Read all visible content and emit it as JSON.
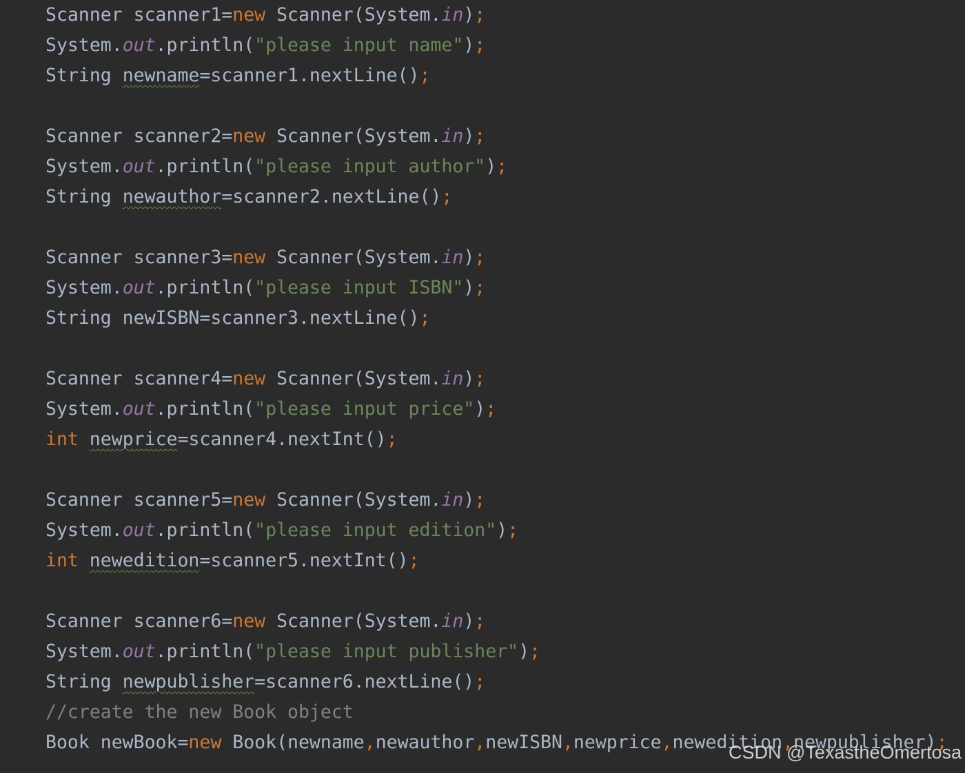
{
  "editor": {
    "theme_colors": {
      "background": "#2b2b2b",
      "default_text": "#a9b7c6",
      "keyword": "#cc7832",
      "static_field": "#9876aa",
      "string": "#6a8759",
      "comment": "#808080",
      "warning_underline": "#5f8c3c"
    },
    "lines": [
      {
        "tokens": [
          {
            "t": "Scanner scanner1="
          },
          {
            "t": "new",
            "c": "kw"
          },
          {
            "t": " Scanner(System."
          },
          {
            "t": "in",
            "c": "fld"
          },
          {
            "t": ")"
          },
          {
            "t": ";",
            "c": "semi"
          }
        ]
      },
      {
        "tokens": [
          {
            "t": "System."
          },
          {
            "t": "out",
            "c": "fld"
          },
          {
            "t": ".println("
          },
          {
            "t": "\"please input name\"",
            "c": "str"
          },
          {
            "t": ")"
          },
          {
            "t": ";",
            "c": "semi"
          }
        ]
      },
      {
        "tokens": [
          {
            "t": "String "
          },
          {
            "t": "newname",
            "c": "warn"
          },
          {
            "t": "=scanner1.nextLine()"
          },
          {
            "t": ";",
            "c": "semi"
          }
        ]
      },
      {
        "tokens": []
      },
      {
        "tokens": [
          {
            "t": "Scanner scanner2="
          },
          {
            "t": "new",
            "c": "kw"
          },
          {
            "t": " Scanner(System."
          },
          {
            "t": "in",
            "c": "fld"
          },
          {
            "t": ")"
          },
          {
            "t": ";",
            "c": "semi"
          }
        ]
      },
      {
        "tokens": [
          {
            "t": "System."
          },
          {
            "t": "out",
            "c": "fld"
          },
          {
            "t": ".println("
          },
          {
            "t": "\"please input author\"",
            "c": "str"
          },
          {
            "t": ")"
          },
          {
            "t": ";",
            "c": "semi"
          }
        ]
      },
      {
        "tokens": [
          {
            "t": "String "
          },
          {
            "t": "newauthor",
            "c": "warn"
          },
          {
            "t": "=scanner2.nextLine()"
          },
          {
            "t": ";",
            "c": "semi"
          }
        ]
      },
      {
        "tokens": []
      },
      {
        "tokens": [
          {
            "t": "Scanner scanner3="
          },
          {
            "t": "new",
            "c": "kw"
          },
          {
            "t": " Scanner(System."
          },
          {
            "t": "in",
            "c": "fld"
          },
          {
            "t": ")"
          },
          {
            "t": ";",
            "c": "semi"
          }
        ]
      },
      {
        "tokens": [
          {
            "t": "System."
          },
          {
            "t": "out",
            "c": "fld"
          },
          {
            "t": ".println("
          },
          {
            "t": "\"please input ISBN\"",
            "c": "str"
          },
          {
            "t": ")"
          },
          {
            "t": ";",
            "c": "semi"
          }
        ]
      },
      {
        "tokens": [
          {
            "t": "String newISBN=scanner3.nextLine()"
          },
          {
            "t": ";",
            "c": "semi"
          }
        ]
      },
      {
        "tokens": []
      },
      {
        "tokens": [
          {
            "t": "Scanner scanner4="
          },
          {
            "t": "new",
            "c": "kw"
          },
          {
            "t": " Scanner(System."
          },
          {
            "t": "in",
            "c": "fld"
          },
          {
            "t": ")"
          },
          {
            "t": ";",
            "c": "semi"
          }
        ]
      },
      {
        "tokens": [
          {
            "t": "System."
          },
          {
            "t": "out",
            "c": "fld"
          },
          {
            "t": ".println("
          },
          {
            "t": "\"please input price\"",
            "c": "str"
          },
          {
            "t": ")"
          },
          {
            "t": ";",
            "c": "semi"
          }
        ]
      },
      {
        "tokens": [
          {
            "t": "int",
            "c": "kw"
          },
          {
            "t": " "
          },
          {
            "t": "newprice",
            "c": "warn"
          },
          {
            "t": "=scanner4.nextInt()"
          },
          {
            "t": ";",
            "c": "semi"
          }
        ]
      },
      {
        "tokens": []
      },
      {
        "tokens": [
          {
            "t": "Scanner scanner5="
          },
          {
            "t": "new",
            "c": "kw"
          },
          {
            "t": " Scanner(System."
          },
          {
            "t": "in",
            "c": "fld"
          },
          {
            "t": ")"
          },
          {
            "t": ";",
            "c": "semi"
          }
        ]
      },
      {
        "tokens": [
          {
            "t": "System."
          },
          {
            "t": "out",
            "c": "fld"
          },
          {
            "t": ".println("
          },
          {
            "t": "\"please input edition\"",
            "c": "str"
          },
          {
            "t": ")"
          },
          {
            "t": ";",
            "c": "semi"
          }
        ]
      },
      {
        "tokens": [
          {
            "t": "int",
            "c": "kw"
          },
          {
            "t": " "
          },
          {
            "t": "newedition",
            "c": "warn"
          },
          {
            "t": "=scanner5.nextInt()"
          },
          {
            "t": ";",
            "c": "semi"
          }
        ]
      },
      {
        "tokens": []
      },
      {
        "tokens": [
          {
            "t": "Scanner scanner6="
          },
          {
            "t": "new",
            "c": "kw"
          },
          {
            "t": " Scanner(System."
          },
          {
            "t": "in",
            "c": "fld"
          },
          {
            "t": ")"
          },
          {
            "t": ";",
            "c": "semi"
          }
        ]
      },
      {
        "tokens": [
          {
            "t": "System."
          },
          {
            "t": "out",
            "c": "fld"
          },
          {
            "t": ".println("
          },
          {
            "t": "\"please input publisher\"",
            "c": "str"
          },
          {
            "t": ")"
          },
          {
            "t": ";",
            "c": "semi"
          }
        ]
      },
      {
        "tokens": [
          {
            "t": "String "
          },
          {
            "t": "newpublisher",
            "c": "warn"
          },
          {
            "t": "=scanner6.nextLine()"
          },
          {
            "t": ";",
            "c": "semi"
          }
        ]
      },
      {
        "tokens": [
          {
            "t": "//create the new Book object",
            "c": "cmt"
          }
        ]
      },
      {
        "tokens": [
          {
            "t": "Book newBook="
          },
          {
            "t": "new",
            "c": "kw"
          },
          {
            "t": " Book(newname"
          },
          {
            "t": ",",
            "c": "semi"
          },
          {
            "t": "newauthor"
          },
          {
            "t": ",",
            "c": "semi"
          },
          {
            "t": "newISBN"
          },
          {
            "t": ",",
            "c": "semi"
          },
          {
            "t": "newprice"
          },
          {
            "t": ",",
            "c": "semi"
          },
          {
            "t": "newedition"
          },
          {
            "t": ",",
            "c": "semi"
          },
          {
            "t": "newpublisher)"
          },
          {
            "t": ";",
            "c": "semi"
          }
        ]
      }
    ]
  },
  "watermark": {
    "text": "CSDN @TexastheOmertosa"
  }
}
